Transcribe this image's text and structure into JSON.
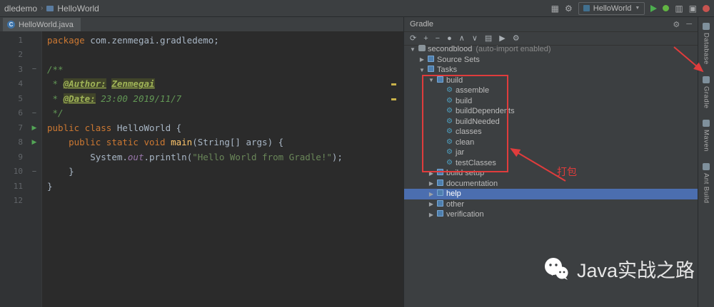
{
  "titlebar": {
    "breadcrumb": {
      "left": "dledemo",
      "project": "HelloWorld"
    },
    "run_config": "HelloWorld"
  },
  "editor": {
    "tab_label": "HelloWorld.java",
    "lines": [
      {
        "n": 1,
        "tokens": [
          {
            "t": "package ",
            "c": "kw"
          },
          {
            "t": "com.zenmegai.gradledemo;",
            "c": "plain"
          }
        ]
      },
      {
        "n": 2,
        "tokens": []
      },
      {
        "n": 3,
        "mark": "fold",
        "tokens": [
          {
            "t": "/**",
            "c": "doc"
          }
        ]
      },
      {
        "n": 4,
        "tokens": [
          {
            "t": " * ",
            "c": "doc"
          },
          {
            "t": "@Author:",
            "c": "hl"
          },
          {
            "t": " ",
            "c": "doc"
          },
          {
            "t": "Zenmegai",
            "c": "hl"
          }
        ]
      },
      {
        "n": 5,
        "tokens": [
          {
            "t": " * ",
            "c": "doc"
          },
          {
            "t": "@Date:",
            "c": "hl"
          },
          {
            "t": " ",
            "c": "doc"
          },
          {
            "t": "23:00 2019/11/7",
            "c": "doc"
          }
        ]
      },
      {
        "n": 6,
        "mark": "fold",
        "tokens": [
          {
            "t": " */",
            "c": "doc"
          }
        ]
      },
      {
        "n": 7,
        "mark": "run",
        "tokens": [
          {
            "t": "public class ",
            "c": "kw"
          },
          {
            "t": "HelloWorld ",
            "c": "plain"
          },
          {
            "t": "{",
            "c": "plain"
          }
        ]
      },
      {
        "n": 8,
        "mark": "run",
        "tokens": [
          {
            "t": "    ",
            "c": "plain"
          },
          {
            "t": "public static void ",
            "c": "kw"
          },
          {
            "t": "main",
            "c": "method"
          },
          {
            "t": "(String[] args) {",
            "c": "plain"
          }
        ]
      },
      {
        "n": 9,
        "tokens": [
          {
            "t": "        ",
            "c": "plain"
          },
          {
            "t": "System.",
            "c": "plain"
          },
          {
            "t": "out",
            "c": "field"
          },
          {
            "t": ".println(",
            "c": "plain"
          },
          {
            "t": "\"Hello World from Gradle!\"",
            "c": "str"
          },
          {
            "t": ");",
            "c": "plain"
          }
        ]
      },
      {
        "n": 10,
        "mark": "fold",
        "tokens": [
          {
            "t": "    }",
            "c": "plain"
          }
        ]
      },
      {
        "n": 11,
        "tokens": [
          {
            "t": "}",
            "c": "plain"
          }
        ]
      },
      {
        "n": 12,
        "tokens": []
      }
    ]
  },
  "gradle": {
    "title": "Gradle",
    "toolbar_icons": [
      "refresh-icon",
      "add-icon",
      "detach-icon",
      "run-gradle-icon",
      "expand-all-icon",
      "collapse-all-icon",
      "group-tasks-icon",
      "execute-icon",
      "settings-wrench-icon"
    ],
    "annotation_label": "打包",
    "tree": [
      {
        "level": 0,
        "arrow": "expanded",
        "icon": "project",
        "label": "secondblood",
        "suffix": "(auto-import enabled)"
      },
      {
        "level": 1,
        "arrow": "collapsed",
        "icon": "group",
        "label": "Source Sets"
      },
      {
        "level": 1,
        "arrow": "expanded",
        "icon": "group",
        "label": "Tasks"
      },
      {
        "level": 2,
        "arrow": "expanded",
        "icon": "group",
        "label": "build"
      },
      {
        "level": 3,
        "arrow": "none",
        "icon": "task",
        "label": "assemble"
      },
      {
        "level": 3,
        "arrow": "none",
        "icon": "task",
        "label": "build"
      },
      {
        "level": 3,
        "arrow": "none",
        "icon": "task",
        "label": "buildDependents"
      },
      {
        "level": 3,
        "arrow": "none",
        "icon": "task",
        "label": "buildNeeded"
      },
      {
        "level": 3,
        "arrow": "none",
        "icon": "task",
        "label": "classes"
      },
      {
        "level": 3,
        "arrow": "none",
        "icon": "task",
        "label": "clean"
      },
      {
        "level": 3,
        "arrow": "none",
        "icon": "task",
        "label": "jar"
      },
      {
        "level": 3,
        "arrow": "none",
        "icon": "task",
        "label": "testClasses"
      },
      {
        "level": 2,
        "arrow": "collapsed",
        "icon": "group",
        "label": "build setup"
      },
      {
        "level": 2,
        "arrow": "collapsed",
        "icon": "group",
        "label": "documentation"
      },
      {
        "level": 2,
        "arrow": "collapsed",
        "icon": "group",
        "label": "help",
        "selected": true
      },
      {
        "level": 2,
        "arrow": "collapsed",
        "icon": "group",
        "label": "other"
      },
      {
        "level": 2,
        "arrow": "collapsed",
        "icon": "group",
        "label": "verification"
      }
    ]
  },
  "right_strip": {
    "items": [
      {
        "label": "Database",
        "icon": "database-icon"
      },
      {
        "label": "Gradle",
        "icon": "gradle-icon"
      },
      {
        "label": "Maven",
        "icon": "maven-icon"
      },
      {
        "label": "Ant Build",
        "icon": "ant-icon"
      }
    ]
  },
  "watermark": {
    "text": "Java实战之路"
  },
  "colors": {
    "selection": "#4b6eaf",
    "annotation": "#e03c3c"
  }
}
